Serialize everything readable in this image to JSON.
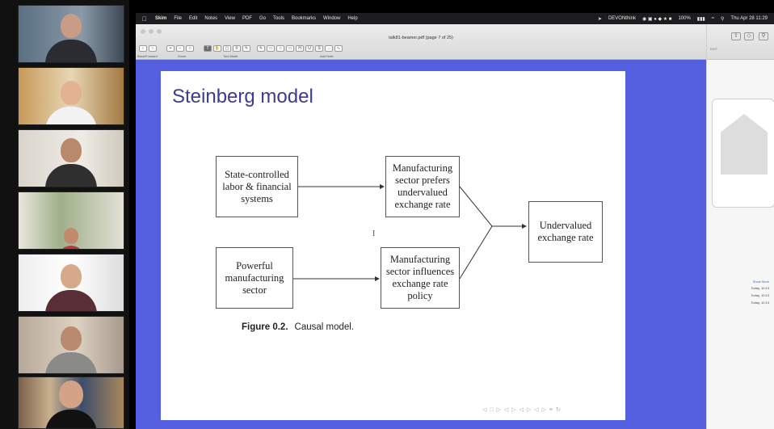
{
  "menubar": {
    "app_name": "Skim",
    "menus": [
      "File",
      "Edit",
      "Notes",
      "View",
      "PDF",
      "Go",
      "Tools",
      "Bookmarks",
      "Window",
      "Help"
    ],
    "status_app": "DEVONthink",
    "battery": "100%",
    "clock": "Thu Apr 28 11:29"
  },
  "window": {
    "doc_title": "talk81-beamer.pdf (page 7 of 25)",
    "toolbar_labels": {
      "back_forward": "Back/Forward",
      "zoom": "Zoom",
      "tool_mode": "Tool Mode",
      "add_note": "Add Note"
    }
  },
  "slide": {
    "title": "Steinberg model",
    "boxes": {
      "state_controlled": "State-controlled labor & financial systems",
      "pref_undervalued": "Manufacturing sector prefers undervalued exchange rate",
      "powerful_sector": "Powerful manufacturing sector",
      "influences_policy": "Manufacturing sector influences exchange rate policy",
      "undervalued_rate": "Undervalued exchange rate"
    },
    "caption_label": "Figure 0.2.",
    "caption_text": "Causal model.",
    "cursor_glyph": "I",
    "nav_symbols": "◁ □ ▷ ◁ ▷ ◁ ▷ ◁ ▷ ≡ ↻"
  },
  "side_panel": {
    "tabs": "EDIT",
    "show_more": "Show More",
    "items": [
      "Today, 10:13",
      "Today, 10:13",
      "Today, 10:13"
    ]
  },
  "icons": [
    "apple-icon",
    "wifi-icon",
    "battery-icon",
    "search-icon",
    "traffic-lights"
  ]
}
